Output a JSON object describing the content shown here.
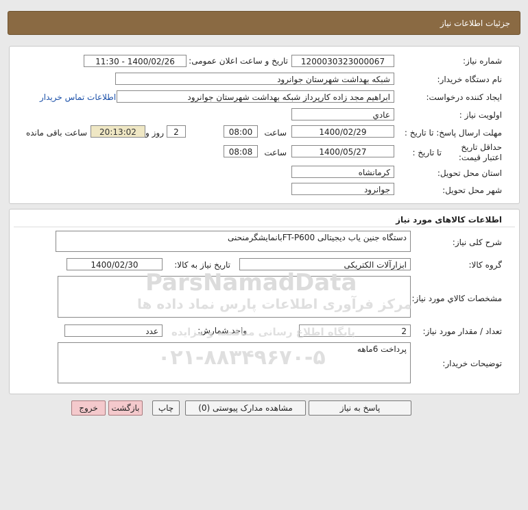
{
  "header": {
    "title": "جزئیات اطلاعات نیاز"
  },
  "info": {
    "need_number_label": "شماره نیاز:",
    "need_number": "1200030323000067",
    "announce_label": "تاریخ و ساعت اعلان عمومی:",
    "announce_value": "1400/02/26 - 11:30",
    "buyer_label": "نام دستگاه خریدار:",
    "buyer_value": "شبکه بهداشت شهرستان جوانرود",
    "creator_label": "ایجاد کننده درخواست:",
    "creator_value": "ابراهیم مجد زاده کارپرداز شبکه بهداشت شهرستان جوانرود",
    "contact_link": "اطلاعات تماس خریدار",
    "priority_label": "اولویت نیاز :",
    "priority_value": "عادي",
    "deadline_label": "مهلت ارسال پاسخ: تا تاریخ :",
    "deadline_date": "1400/02/29",
    "time_label": "ساعت",
    "deadline_time": "08:00",
    "days_value": "2",
    "days_label": "روز و",
    "timer_value": "20:13:02",
    "remaining_label": "ساعت باقی مانده",
    "validity_label": "حداقل تاریخ اعتبار قیمت:",
    "validity_to_label": "تا تاریخ :",
    "validity_date": "1400/05/27",
    "validity_time_label": "ساعت",
    "validity_time": "08:08",
    "province_label": "استان محل تحویل:",
    "province_value": "کرمانشاه",
    "city_label": "شهر محل تحویل:",
    "city_value": "جوانرود"
  },
  "goods": {
    "section_title": "اطلاعات کالاهای مورد نیاز",
    "desc_label": "شرح کلی نیاز:",
    "desc_value": "دستگاه جنین یاب دیجیتالی FT-P600بانمایشگرمنحنی",
    "group_label": "گروه کالا:",
    "group_value": "ابزارآلات الکتریکی",
    "need_date_label": "تاریخ نیاز به کالا:",
    "need_date_value": "1400/02/30",
    "specs_label": "مشخصات کالاي مورد نیاز:",
    "specs_value": "",
    "qty_label": "تعداد / مقدار مورد نیاز:",
    "qty_value": "2",
    "unit_label": "واحد شمارش:",
    "unit_value": "عدد",
    "notes_label": "توضیحات خریدار:",
    "notes_value": "پرداخت 6ماهه"
  },
  "buttons": {
    "reply": "پاسخ به نیاز",
    "attachments": "مشاهده مدارک پیوستی (0)",
    "print": "چاپ",
    "back": "بازگشت",
    "exit": "خروج"
  },
  "watermark": {
    "brand": "ParsNamadData",
    "line1": "مرکز فرآوری اطلاعات پارس نماد داده ها",
    "line2": "پایگاه اطلاع رسانی مناقصه و مزایده",
    "phone": "۰۲۱-۸۸۳۴۹۶۷۰-۵"
  }
}
